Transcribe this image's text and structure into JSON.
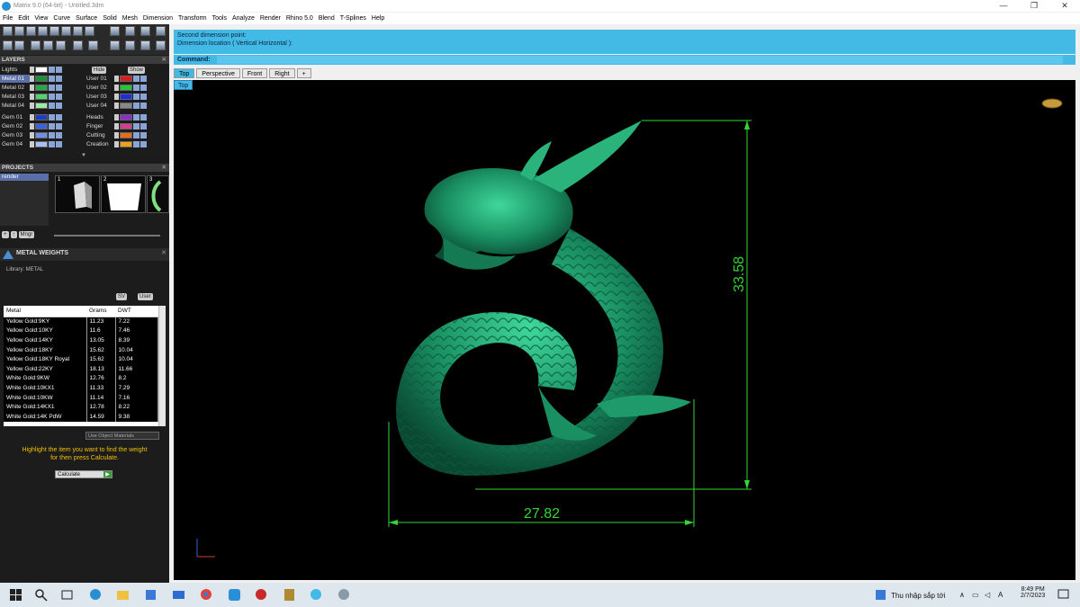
{
  "window": {
    "title": "Matrix 9.0 (64-bit) - Untitled.3dm",
    "min": "—",
    "restore": "❐",
    "close": "✕"
  },
  "menu": [
    "File",
    "Edit",
    "View",
    "Curve",
    "Surface",
    "Solid",
    "Mesh",
    "Dimension",
    "Transform",
    "Tools",
    "Analyze",
    "Render",
    "Rhino 5.0",
    "Blend",
    "T-Splines",
    "Help"
  ],
  "layers": {
    "title": "LAYERS",
    "lights": "Lights",
    "hide": "Hide",
    "show": "Show",
    "rows_left": [
      {
        "label": "Metal 01",
        "color": "#1b8f3a",
        "selected": true
      },
      {
        "label": "Metal 02",
        "color": "#27a847",
        "selected": false
      },
      {
        "label": "Metal 03",
        "color": "#4fd66a",
        "selected": false
      },
      {
        "label": "Metal 04",
        "color": "#9ee8a8",
        "selected": false
      },
      {
        "label": "Gem 01",
        "color": "#1e3fbf",
        "selected": false
      },
      {
        "label": "Gem 02",
        "color": "#3b62d9",
        "selected": false
      },
      {
        "label": "Gem 03",
        "color": "#6f8fe8",
        "selected": false
      },
      {
        "label": "Gem 04",
        "color": "#a9bff2",
        "selected": false
      }
    ],
    "rows_right": [
      {
        "label": "User 01",
        "color": "#e11b1b"
      },
      {
        "label": "User 02",
        "color": "#27c437"
      },
      {
        "label": "User 03",
        "color": "#1b2ee1"
      },
      {
        "label": "User 04",
        "color": "#888888"
      },
      {
        "label": "Heads",
        "color": "#8b2fc9"
      },
      {
        "label": "Finger",
        "color": "#d43f8d"
      },
      {
        "label": "Cutting",
        "color": "#e86a1b"
      },
      {
        "label": "Creation",
        "color": "#f0a020"
      }
    ]
  },
  "projects": {
    "title": "PROJECTS",
    "item": "render",
    "mngr": "Mngr",
    "thumb_numbers": [
      "1",
      "2",
      "3"
    ]
  },
  "metal_weights": {
    "title": "METAL WEIGHTS",
    "library": "Library: METAL",
    "btn_sv": "SV",
    "btn_user": "User",
    "columns": [
      "Metal",
      "Grams",
      "DWT"
    ],
    "rows": [
      [
        "Yellow Gold:9KY",
        "11.23",
        "7.22"
      ],
      [
        "Yellow Gold:10KY",
        "11.6",
        "7.46"
      ],
      [
        "Yellow Gold:14KY",
        "13.05",
        "8.39"
      ],
      [
        "Yellow Gold:18KY",
        "15.62",
        "10.04"
      ],
      [
        "Yellow Gold:18KY Royal",
        "15.62",
        "10.04"
      ],
      [
        "Yellow Gold:22KY",
        "18.13",
        "11.66"
      ],
      [
        "White Gold:9KW",
        "12.76",
        "8.2"
      ],
      [
        "White Gold:10KX1",
        "11.33",
        "7.29"
      ],
      [
        "White Gold:10KW",
        "11.14",
        "7.16"
      ],
      [
        "White Gold:14KX1",
        "12.78",
        "8.22"
      ],
      [
        "White Gold:14K PdW",
        "14.59",
        "9.38"
      ]
    ],
    "use_object_materials": "Use Object Materials",
    "hint_line1": "Highlight the item you want to find the weight",
    "hint_line2": "for then press Calculate.",
    "calculate": "Calculate"
  },
  "command": {
    "line1": "Second dimension point:",
    "line2": "Dimension location ( Vertical  Horizontal ):",
    "label": "Command:"
  },
  "view_tabs": [
    "Top",
    "Perspective",
    "Front",
    "Right",
    "+"
  ],
  "viewport": {
    "label": "Top",
    "dim_height": "33.58",
    "dim_width": "27.82",
    "dim_color": "#33d633",
    "model_color": "#1f9a6a"
  },
  "taskbar": {
    "news": "Thu nhập sắp tới",
    "time": "8:49 PM",
    "date": "2/7/2023"
  }
}
